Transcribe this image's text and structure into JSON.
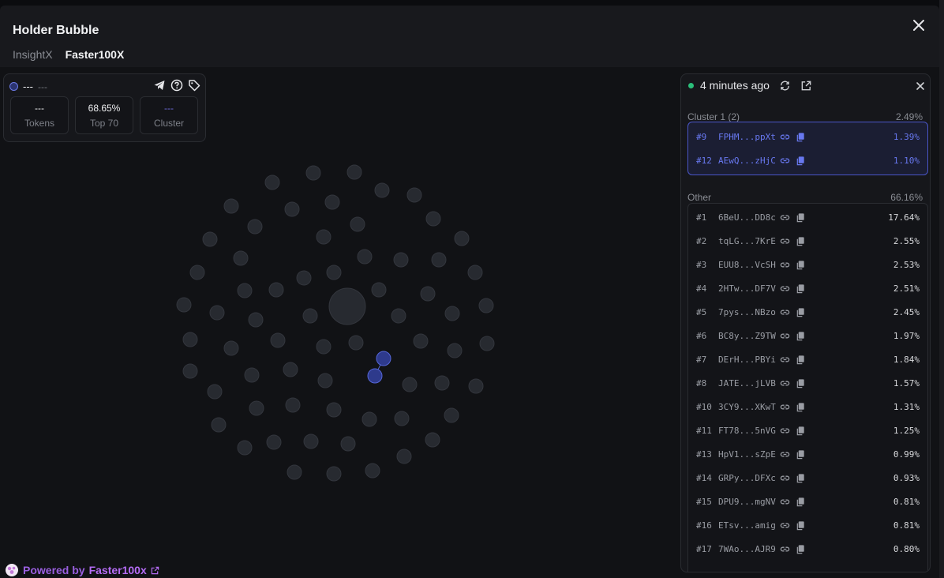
{
  "header": {
    "title": "Holder Bubble",
    "tabs": [
      {
        "label": "InsightX",
        "active": false
      },
      {
        "label": "Faster100X",
        "active": true
      }
    ]
  },
  "stats": {
    "name": "---",
    "symbol": "---",
    "boxes": [
      {
        "value": "---",
        "label": "Tokens"
      },
      {
        "value": "68.65%",
        "label": "Top 70"
      },
      {
        "value": "---",
        "label": "Cluster"
      }
    ],
    "icons": [
      "telegram-icon",
      "help-icon",
      "tag-icon"
    ]
  },
  "panel": {
    "updated": "4 minutes ago",
    "cluster": {
      "title": "Cluster 1 (2)",
      "total": "2.49%",
      "holders": [
        {
          "rank": "#9",
          "addr": "FPHM...ppXt",
          "pct": "1.39%"
        },
        {
          "rank": "#12",
          "addr": "AEwQ...zHjC",
          "pct": "1.10%"
        }
      ]
    },
    "other": {
      "title": "Other",
      "total": "66.16%",
      "holders": [
        {
          "rank": "#1",
          "addr": "6BeU...DD8c",
          "pct": "17.64%"
        },
        {
          "rank": "#2",
          "addr": "tqLG...7KrE",
          "pct": "2.55%"
        },
        {
          "rank": "#3",
          "addr": "EUU8...VcSH",
          "pct": "2.53%"
        },
        {
          "rank": "#4",
          "addr": "2HTw...DF7V",
          "pct": "2.51%"
        },
        {
          "rank": "#5",
          "addr": "7pys...NBzo",
          "pct": "2.45%"
        },
        {
          "rank": "#6",
          "addr": "BC8y...Z9TW",
          "pct": "1.97%"
        },
        {
          "rank": "#7",
          "addr": "DErH...PBYi",
          "pct": "1.84%"
        },
        {
          "rank": "#8",
          "addr": "JATE...jLVB",
          "pct": "1.57%"
        },
        {
          "rank": "#10",
          "addr": "3CY9...XKwT",
          "pct": "1.31%"
        },
        {
          "rank": "#11",
          "addr": "FT78...5nVG",
          "pct": "1.25%"
        },
        {
          "rank": "#13",
          "addr": "HpV1...sZpE",
          "pct": "0.99%"
        },
        {
          "rank": "#14",
          "addr": "GRPy...DFXc",
          "pct": "0.93%"
        },
        {
          "rank": "#15",
          "addr": "DPU9...mgNV",
          "pct": "0.81%"
        },
        {
          "rank": "#16",
          "addr": "ETsv...amig",
          "pct": "0.81%"
        },
        {
          "rank": "#17",
          "addr": "7WAo...AJR9",
          "pct": "0.80%"
        }
      ]
    }
  },
  "footer": {
    "prefix": "Powered by",
    "name": "Faster100x"
  },
  "colors": {
    "bubble": "#272a30",
    "bubble_border": "#33363d",
    "cluster_bubble": "#2e3a8c",
    "cluster_border": "#5566d8",
    "accent": "#6878f0",
    "live": "#2bbf7a",
    "powered": "#b56cf5"
  }
}
